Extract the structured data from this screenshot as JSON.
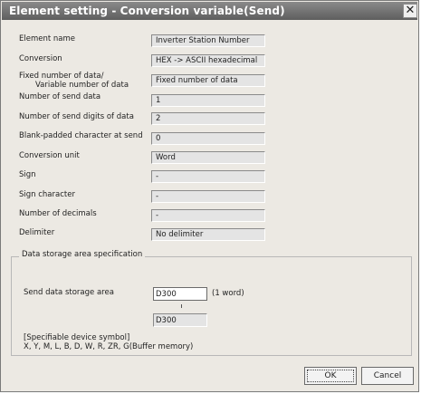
{
  "window": {
    "title": "Element setting - Conversion variable(Send)",
    "close_glyph": "✕"
  },
  "fields": [
    {
      "label": "Element name",
      "value": "Inverter Station Number"
    },
    {
      "label": "Conversion",
      "value": "HEX -> ASCII hexadecimal"
    },
    {
      "label_line1": "Fixed number of data/",
      "label_line2": "Variable number of data",
      "value": "Fixed number of data"
    },
    {
      "label": "Number of send data",
      "value": "1"
    },
    {
      "label": "Number of send digits of data",
      "value": "2"
    },
    {
      "label": "Blank-padded character at send",
      "value": "0"
    },
    {
      "label": "Conversion unit",
      "value": "Word"
    },
    {
      "label": "Sign",
      "value": "-"
    },
    {
      "label": "Sign character",
      "value": "-"
    },
    {
      "label": "Number of decimals",
      "value": "-"
    },
    {
      "label": "Delimiter",
      "value": "No delimiter"
    }
  ],
  "storage": {
    "group_title": "Data storage area specification",
    "label": "Send data storage area",
    "input_value": "D300",
    "unit": "(1 word)",
    "end_value": "D300",
    "note_line1": "[Specifiable device symbol]",
    "note_line2": "X, Y, M, L, B, D, W, R, ZR, G(Buffer memory)"
  },
  "buttons": {
    "ok": "OK",
    "cancel": "Cancel"
  }
}
